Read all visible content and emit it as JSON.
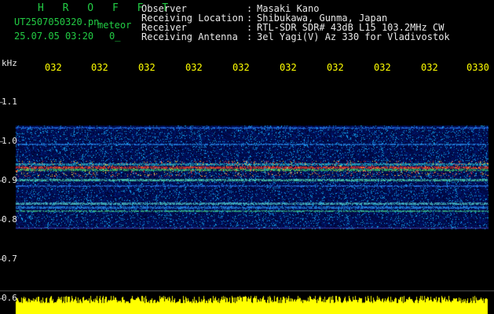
{
  "header": {
    "title": "H R O F F T",
    "filename": "UT2507050320.pn",
    "meteor_label": "meteor",
    "datetime": "25.07.05 03:20",
    "count": "0_"
  },
  "info": {
    "labels": [
      "Observer",
      "Receiving Location",
      "Receiver",
      "Receiving Antenna"
    ],
    "separators": [
      ":",
      ":",
      ":",
      ":"
    ],
    "values": [
      "Masaki Kano",
      "Shibukawa, Gunma, Japan",
      "RTL-SDR SDR# 43dB L15 103.2MHz CW",
      "3el Yagi(V) Az 330 for Vladivostok"
    ]
  },
  "axes": {
    "unit": "kHz",
    "y_ticks": [
      "1.1",
      "1.0",
      "0.9",
      "0.8",
      "0.7",
      "0.6"
    ],
    "time_ticks": [
      "032",
      "032",
      "032",
      "032",
      "032",
      "032",
      "032",
      "032",
      "032",
      "0330"
    ]
  },
  "colors": {
    "background": "#000000",
    "header_title": "#22cc44",
    "header_text": "#22cc44",
    "info_text": "#e8e8e8",
    "tick_text": "#ffff00",
    "axis_text": "#e8e8e8",
    "signal_bar": "#ffff00"
  }
}
